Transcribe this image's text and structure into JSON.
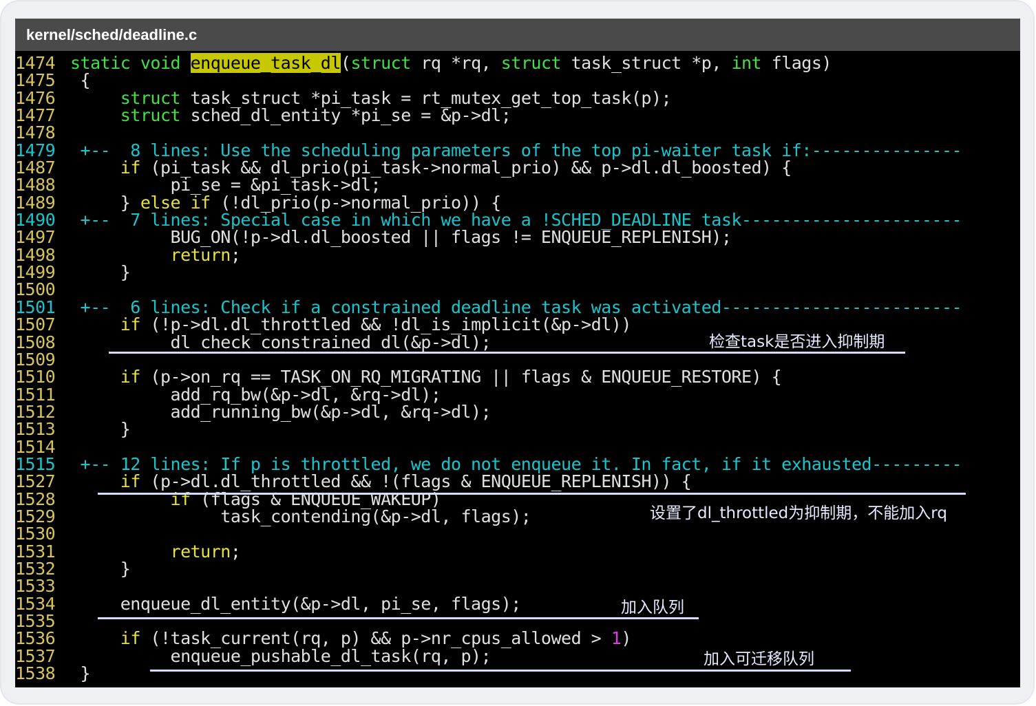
{
  "window": {
    "title": "kernel/sched/deadline.c"
  },
  "code": {
    "lines": [
      {
        "n": "1474",
        "parts": [
          [
            "ty",
            "static void "
          ],
          [
            "hl",
            "enqueue_task_dl"
          ],
          [
            "tx",
            "("
          ],
          [
            "ty",
            "struct"
          ],
          [
            "tx",
            " rq *rq, "
          ],
          [
            "ty",
            "struct"
          ],
          [
            "tx",
            " task_struct *p, "
          ],
          [
            "ty",
            "int"
          ],
          [
            "tx",
            " flags)"
          ]
        ]
      },
      {
        "n": "1475",
        "parts": [
          [
            "tx",
            " {"
          ]
        ]
      },
      {
        "n": "1476",
        "parts": [
          [
            "tx",
            "     "
          ],
          [
            "ty",
            "struct"
          ],
          [
            "tx",
            " task_struct *pi_task = rt_mutex_get_top_task(p);"
          ]
        ]
      },
      {
        "n": "1477",
        "parts": [
          [
            "tx",
            "     "
          ],
          [
            "ty",
            "struct"
          ],
          [
            "tx",
            " sched_dl_entity *pi_se = &p->dl;"
          ]
        ]
      },
      {
        "n": "1478",
        "parts": []
      },
      {
        "n": "1479",
        "fold": true,
        "parts": [
          [
            "fold-text",
            " +--  8 lines: Use the scheduling parameters of the top pi-waiter task if:---------------"
          ]
        ]
      },
      {
        "n": "1487",
        "parts": [
          [
            "tx",
            "     "
          ],
          [
            "kw",
            "if"
          ],
          [
            "tx",
            " (pi_task && dl_prio(pi_task->normal_prio) && p->dl.dl_boosted) {"
          ]
        ]
      },
      {
        "n": "1488",
        "parts": [
          [
            "tx",
            "          pi_se = &pi_task->dl;"
          ]
        ]
      },
      {
        "n": "1489",
        "parts": [
          [
            "tx",
            "     } "
          ],
          [
            "kw",
            "else if"
          ],
          [
            "tx",
            " (!dl_prio(p->normal_prio)) {"
          ]
        ]
      },
      {
        "n": "1490",
        "fold": true,
        "parts": [
          [
            "fold-text",
            " +--  7 lines: Special case in which we have a !SCHED_DEADLINE task----------------------"
          ]
        ]
      },
      {
        "n": "1497",
        "parts": [
          [
            "tx",
            "          BUG_ON(!p->dl.dl_boosted || flags != ENQUEUE_REPLENISH);"
          ]
        ]
      },
      {
        "n": "1498",
        "parts": [
          [
            "tx",
            "          "
          ],
          [
            "kw",
            "return"
          ],
          [
            "tx",
            ";"
          ]
        ]
      },
      {
        "n": "1499",
        "parts": [
          [
            "tx",
            "     }"
          ]
        ]
      },
      {
        "n": "1500",
        "parts": []
      },
      {
        "n": "1501",
        "fold": true,
        "parts": [
          [
            "fold-text",
            " +--  6 lines: Check if a constrained deadline task was activated------------------------"
          ]
        ]
      },
      {
        "n": "1507",
        "parts": [
          [
            "tx",
            "     "
          ],
          [
            "kw",
            "if"
          ],
          [
            "tx",
            " (!p->dl.dl_throttled && !dl_is_implicit(&p->dl))"
          ]
        ]
      },
      {
        "n": "1508",
        "parts": [
          [
            "tx",
            "          dl_check_constrained_dl(&p->dl);"
          ]
        ]
      },
      {
        "n": "1509",
        "parts": []
      },
      {
        "n": "1510",
        "parts": [
          [
            "tx",
            "     "
          ],
          [
            "kw",
            "if"
          ],
          [
            "tx",
            " (p->on_rq == TASK_ON_RQ_MIGRATING || flags & ENQUEUE_RESTORE) {"
          ]
        ]
      },
      {
        "n": "1511",
        "parts": [
          [
            "tx",
            "          add_rq_bw(&p->dl, &rq->dl);"
          ]
        ]
      },
      {
        "n": "1512",
        "parts": [
          [
            "tx",
            "          add_running_bw(&p->dl, &rq->dl);"
          ]
        ]
      },
      {
        "n": "1513",
        "parts": [
          [
            "tx",
            "     }"
          ]
        ]
      },
      {
        "n": "1514",
        "parts": []
      },
      {
        "n": "1515",
        "fold": true,
        "parts": [
          [
            "fold-text",
            " +-- 12 lines: If p is throttled, we do not enqueue it. In fact, if it exhausted---------"
          ]
        ]
      },
      {
        "n": "1527",
        "parts": [
          [
            "tx",
            "     "
          ],
          [
            "kw",
            "if"
          ],
          [
            "tx",
            " (p->dl.dl_throttled && !(flags & ENQUEUE_REPLENISH)) {"
          ]
        ]
      },
      {
        "n": "1528",
        "parts": [
          [
            "tx",
            "          "
          ],
          [
            "kw",
            "if"
          ],
          [
            "tx",
            " (flags & ENQUEUE_WAKEUP)"
          ]
        ]
      },
      {
        "n": "1529",
        "parts": [
          [
            "tx",
            "               task_contending(&p->dl, flags);"
          ]
        ]
      },
      {
        "n": "1530",
        "parts": []
      },
      {
        "n": "1531",
        "parts": [
          [
            "tx",
            "          "
          ],
          [
            "kw",
            "return"
          ],
          [
            "tx",
            ";"
          ]
        ]
      },
      {
        "n": "1532",
        "parts": [
          [
            "tx",
            "     }"
          ]
        ]
      },
      {
        "n": "1533",
        "parts": []
      },
      {
        "n": "1534",
        "parts": [
          [
            "tx",
            "     enqueue_dl_entity(&p->dl, pi_se, flags);"
          ]
        ]
      },
      {
        "n": "1535",
        "parts": []
      },
      {
        "n": "1536",
        "parts": [
          [
            "tx",
            "     "
          ],
          [
            "kw",
            "if"
          ],
          [
            "tx",
            " (!task_current(rq, p) && p->nr_cpus_allowed > "
          ],
          [
            "num",
            "1"
          ],
          [
            "tx",
            ")"
          ]
        ]
      },
      {
        "n": "1537",
        "parts": [
          [
            "tx",
            "          enqueue_pushable_dl_task(rq, p);"
          ]
        ]
      },
      {
        "n": "1538",
        "parts": [
          [
            "tx",
            " }"
          ]
        ]
      }
    ]
  },
  "annotations": {
    "check_constrained": "检查task是否进入抑制期",
    "throttled": "设置了dl_throttled为抑制期，不能加入rq",
    "enqueue": "加入队列",
    "pushable": "加入可迁移队列"
  }
}
